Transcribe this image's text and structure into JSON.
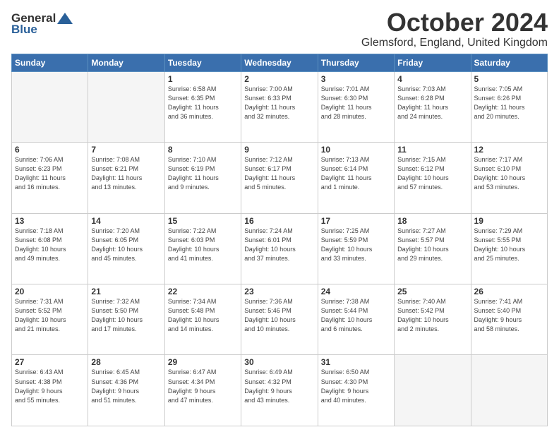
{
  "header": {
    "logo_general": "General",
    "logo_blue": "Blue",
    "month_title": "October 2024",
    "location": "Glemsford, England, United Kingdom"
  },
  "weekdays": [
    "Sunday",
    "Monday",
    "Tuesday",
    "Wednesday",
    "Thursday",
    "Friday",
    "Saturday"
  ],
  "weeks": [
    [
      {
        "day": "",
        "info": ""
      },
      {
        "day": "",
        "info": ""
      },
      {
        "day": "1",
        "info": "Sunrise: 6:58 AM\nSunset: 6:35 PM\nDaylight: 11 hours\nand 36 minutes."
      },
      {
        "day": "2",
        "info": "Sunrise: 7:00 AM\nSunset: 6:33 PM\nDaylight: 11 hours\nand 32 minutes."
      },
      {
        "day": "3",
        "info": "Sunrise: 7:01 AM\nSunset: 6:30 PM\nDaylight: 11 hours\nand 28 minutes."
      },
      {
        "day": "4",
        "info": "Sunrise: 7:03 AM\nSunset: 6:28 PM\nDaylight: 11 hours\nand 24 minutes."
      },
      {
        "day": "5",
        "info": "Sunrise: 7:05 AM\nSunset: 6:26 PM\nDaylight: 11 hours\nand 20 minutes."
      }
    ],
    [
      {
        "day": "6",
        "info": "Sunrise: 7:06 AM\nSunset: 6:23 PM\nDaylight: 11 hours\nand 16 minutes."
      },
      {
        "day": "7",
        "info": "Sunrise: 7:08 AM\nSunset: 6:21 PM\nDaylight: 11 hours\nand 13 minutes."
      },
      {
        "day": "8",
        "info": "Sunrise: 7:10 AM\nSunset: 6:19 PM\nDaylight: 11 hours\nand 9 minutes."
      },
      {
        "day": "9",
        "info": "Sunrise: 7:12 AM\nSunset: 6:17 PM\nDaylight: 11 hours\nand 5 minutes."
      },
      {
        "day": "10",
        "info": "Sunrise: 7:13 AM\nSunset: 6:14 PM\nDaylight: 11 hours\nand 1 minute."
      },
      {
        "day": "11",
        "info": "Sunrise: 7:15 AM\nSunset: 6:12 PM\nDaylight: 10 hours\nand 57 minutes."
      },
      {
        "day": "12",
        "info": "Sunrise: 7:17 AM\nSunset: 6:10 PM\nDaylight: 10 hours\nand 53 minutes."
      }
    ],
    [
      {
        "day": "13",
        "info": "Sunrise: 7:18 AM\nSunset: 6:08 PM\nDaylight: 10 hours\nand 49 minutes."
      },
      {
        "day": "14",
        "info": "Sunrise: 7:20 AM\nSunset: 6:05 PM\nDaylight: 10 hours\nand 45 minutes."
      },
      {
        "day": "15",
        "info": "Sunrise: 7:22 AM\nSunset: 6:03 PM\nDaylight: 10 hours\nand 41 minutes."
      },
      {
        "day": "16",
        "info": "Sunrise: 7:24 AM\nSunset: 6:01 PM\nDaylight: 10 hours\nand 37 minutes."
      },
      {
        "day": "17",
        "info": "Sunrise: 7:25 AM\nSunset: 5:59 PM\nDaylight: 10 hours\nand 33 minutes."
      },
      {
        "day": "18",
        "info": "Sunrise: 7:27 AM\nSunset: 5:57 PM\nDaylight: 10 hours\nand 29 minutes."
      },
      {
        "day": "19",
        "info": "Sunrise: 7:29 AM\nSunset: 5:55 PM\nDaylight: 10 hours\nand 25 minutes."
      }
    ],
    [
      {
        "day": "20",
        "info": "Sunrise: 7:31 AM\nSunset: 5:52 PM\nDaylight: 10 hours\nand 21 minutes."
      },
      {
        "day": "21",
        "info": "Sunrise: 7:32 AM\nSunset: 5:50 PM\nDaylight: 10 hours\nand 17 minutes."
      },
      {
        "day": "22",
        "info": "Sunrise: 7:34 AM\nSunset: 5:48 PM\nDaylight: 10 hours\nand 14 minutes."
      },
      {
        "day": "23",
        "info": "Sunrise: 7:36 AM\nSunset: 5:46 PM\nDaylight: 10 hours\nand 10 minutes."
      },
      {
        "day": "24",
        "info": "Sunrise: 7:38 AM\nSunset: 5:44 PM\nDaylight: 10 hours\nand 6 minutes."
      },
      {
        "day": "25",
        "info": "Sunrise: 7:40 AM\nSunset: 5:42 PM\nDaylight: 10 hours\nand 2 minutes."
      },
      {
        "day": "26",
        "info": "Sunrise: 7:41 AM\nSunset: 5:40 PM\nDaylight: 9 hours\nand 58 minutes."
      }
    ],
    [
      {
        "day": "27",
        "info": "Sunrise: 6:43 AM\nSunset: 4:38 PM\nDaylight: 9 hours\nand 55 minutes."
      },
      {
        "day": "28",
        "info": "Sunrise: 6:45 AM\nSunset: 4:36 PM\nDaylight: 9 hours\nand 51 minutes."
      },
      {
        "day": "29",
        "info": "Sunrise: 6:47 AM\nSunset: 4:34 PM\nDaylight: 9 hours\nand 47 minutes."
      },
      {
        "day": "30",
        "info": "Sunrise: 6:49 AM\nSunset: 4:32 PM\nDaylight: 9 hours\nand 43 minutes."
      },
      {
        "day": "31",
        "info": "Sunrise: 6:50 AM\nSunset: 4:30 PM\nDaylight: 9 hours\nand 40 minutes."
      },
      {
        "day": "",
        "info": ""
      },
      {
        "day": "",
        "info": ""
      }
    ]
  ]
}
